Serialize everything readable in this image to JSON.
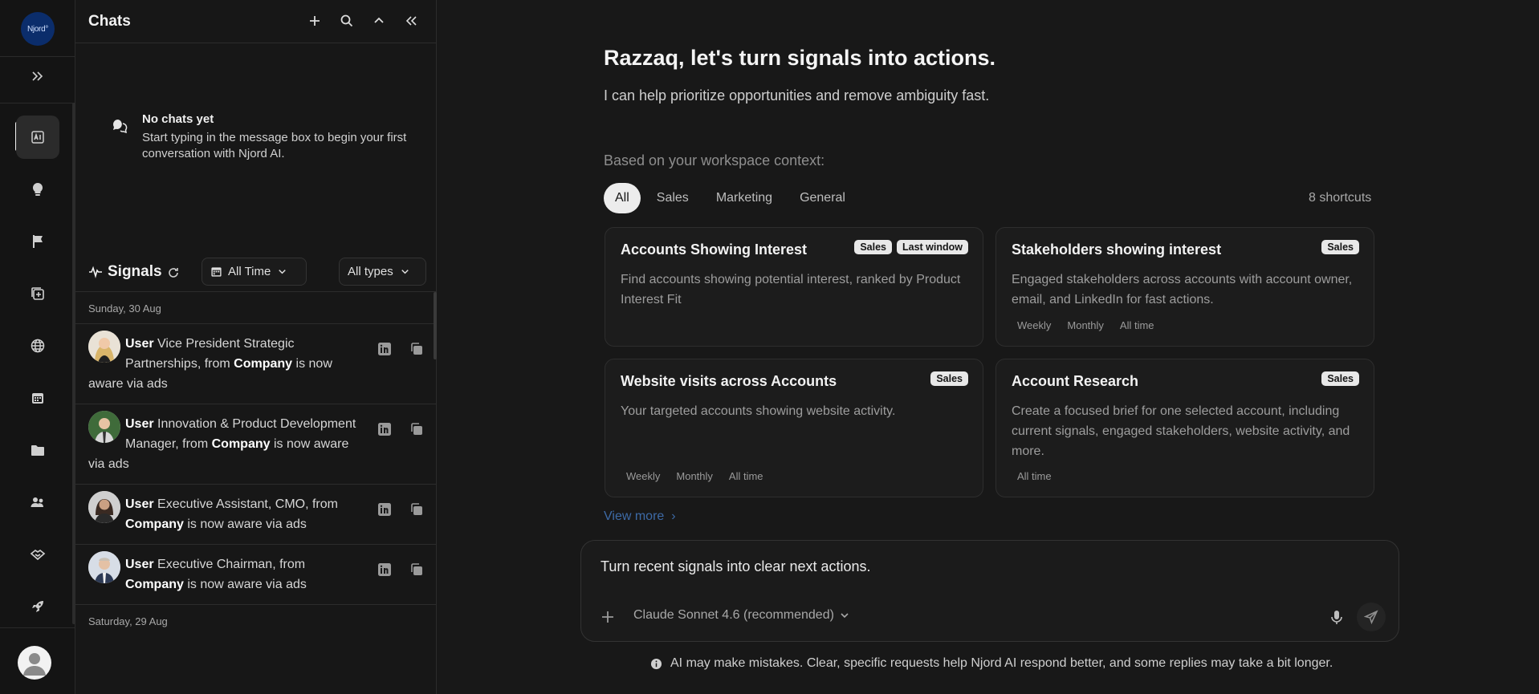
{
  "rail": {
    "logo_text": "Njord°",
    "nav": [
      "expand-icon",
      "ai-chat-icon",
      "lightbulb-icon",
      "flag-icon",
      "add-document-icon",
      "globe-icon",
      "calendar-icon",
      "folder-icon",
      "users-icon",
      "handshake-icon",
      "rocket-icon"
    ],
    "active": "ai-chat-icon"
  },
  "chats": {
    "title": "Chats",
    "header_icons": [
      "plus-icon",
      "search-icon",
      "chevron-up-icon",
      "collapse-left-icon"
    ],
    "empty_title": "No chats yet",
    "empty_text": "Start typing in the message box to begin your first conversation with Njord AI."
  },
  "signals": {
    "title": "Signals",
    "time_filter": "All Time",
    "type_filter": "All types",
    "groups": [
      {
        "date": "Sunday, 30 Aug",
        "items": [
          {
            "user": "User",
            "role": "Vice President Strategic Partnerships, from",
            "company": "Company",
            "tail": "is now aware via ads"
          },
          {
            "user": "User",
            "role": "Innovation & Product Development Manager, from",
            "company": "Company",
            "tail": "is now aware via ads"
          },
          {
            "user": "User",
            "role": "Executive Assistant, CMO, from",
            "company": "Company",
            "tail": "is now aware via ads"
          },
          {
            "user": "User",
            "role": "Executive Chairman, from",
            "company": "Company",
            "tail": "is now aware via ads"
          }
        ]
      },
      {
        "date": "Saturday, 29 Aug",
        "items": []
      }
    ]
  },
  "main": {
    "greeting": "Razzaq, let's turn signals into actions.",
    "subtitle": "I can help prioritize opportunities and remove ambiguity fast.",
    "context_label": "Based on your workspace context:",
    "tabs": [
      "All",
      "Sales",
      "Marketing",
      "General"
    ],
    "active_tab": "All",
    "shortcuts_count": "8 shortcuts",
    "cards": [
      {
        "title": "Accounts Showing Interest",
        "badges": [
          "Sales",
          "Last window"
        ],
        "desc": "Find accounts showing potential interest, ranked by Product Interest Fit",
        "chips": []
      },
      {
        "title": "Stakeholders showing interest",
        "badges": [
          "Sales"
        ],
        "desc": "Engaged stakeholders across accounts with account owner, email, and LinkedIn for fast actions.",
        "chips": [
          "Weekly",
          "Monthly",
          "All time"
        ]
      },
      {
        "title": "Website visits across Accounts",
        "badges": [
          "Sales"
        ],
        "desc": "Your targeted accounts showing website activity.",
        "chips": [
          "Weekly",
          "Monthly",
          "All time"
        ]
      },
      {
        "title": "Account Research",
        "badges": [
          "Sales"
        ],
        "desc": "Create a focused brief for one selected account, including current signals, engaged stakeholders, website activity, and more.",
        "chips": [
          "All time"
        ]
      }
    ],
    "view_more": "View more",
    "composer": {
      "input_value": "Turn recent signals into clear next actions.",
      "model": "Claude Sonnet 4.6 (recommended)"
    },
    "disclaimer": "AI may make mistakes. Clear, specific requests help Njord AI respond better, and some replies may take a bit longer."
  }
}
